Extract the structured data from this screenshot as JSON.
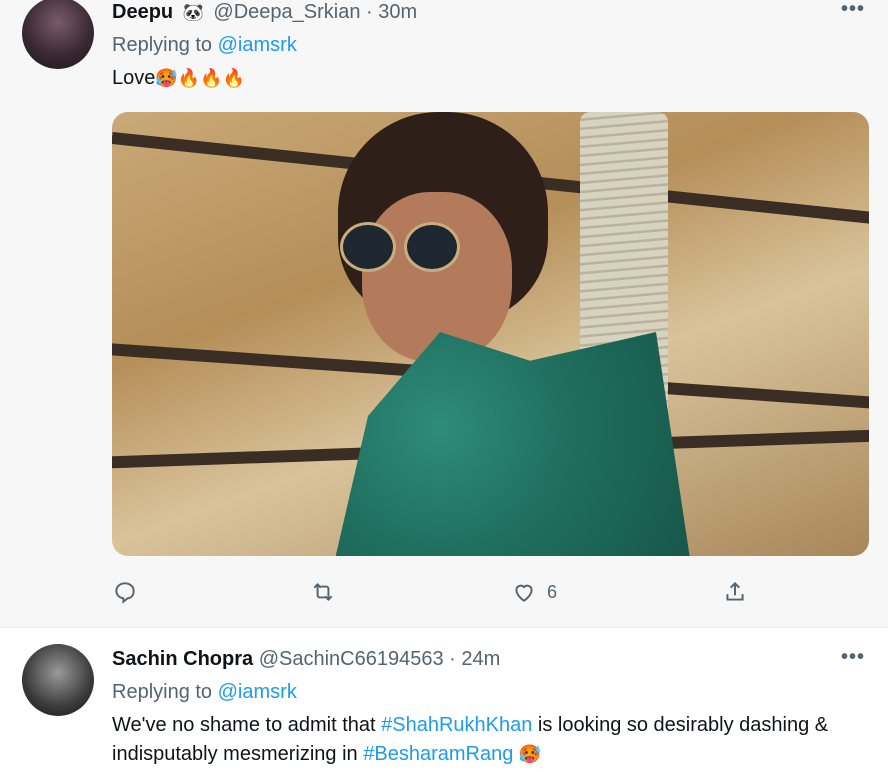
{
  "tweets": [
    {
      "name": "Deepu",
      "badge_emoji": "🐼",
      "handle": "@Deepa_Srkian",
      "separator": "·",
      "time": "30m",
      "replying_label": "Replying to",
      "replying_to": "@iamsrk",
      "text": "Love",
      "text_emojis": "🥵🔥🔥🔥",
      "more_label": "•••",
      "actions": {
        "reply": "",
        "retweet": "",
        "like_count": "6",
        "share": ""
      }
    },
    {
      "name": "Sachin Chopra",
      "handle": "@SachinC66194563",
      "separator": "·",
      "time": "24m",
      "replying_label": "Replying to",
      "replying_to": "@iamsrk",
      "text_part1": "We've no shame to admit that ",
      "hashtag1": "#ShahRukhKhan",
      "text_part2": " is looking so desirably dashing & indisputably mesmerizing in ",
      "hashtag2": "#BesharamRang",
      "text_emoji": "🥵",
      "more_label": "•••"
    }
  ],
  "colors": {
    "accent": "#1d9bf0",
    "secondary_text": "#536471",
    "primary_text": "#0f1419",
    "highlight_bg": "#f7f7f7"
  }
}
